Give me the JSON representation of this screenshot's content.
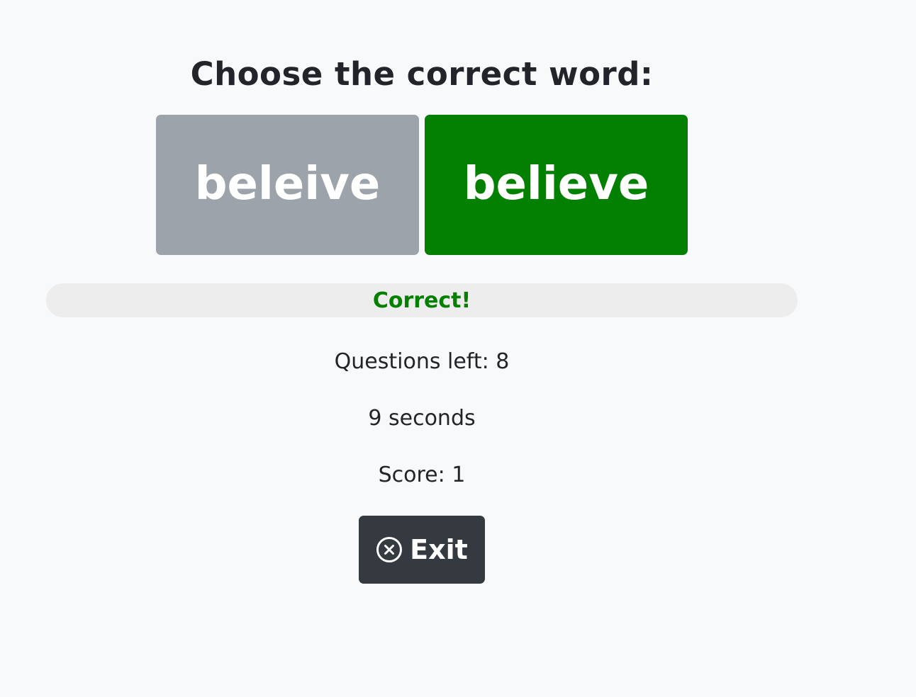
{
  "prompt": {
    "title": "Choose the correct word:"
  },
  "choices": [
    {
      "label": "beleive",
      "state": "wrong",
      "color": "#9ca3aa"
    },
    {
      "label": "believe",
      "state": "correct",
      "color": "#048000"
    }
  ],
  "feedback": {
    "text": "Correct!",
    "color": "#048000"
  },
  "status": {
    "questions_left": "Questions left: 8",
    "timer": "9 seconds",
    "score": "Score: 1"
  },
  "exit_button": {
    "label": "Exit",
    "icon": "close-circle-icon",
    "color": "#343a40"
  }
}
